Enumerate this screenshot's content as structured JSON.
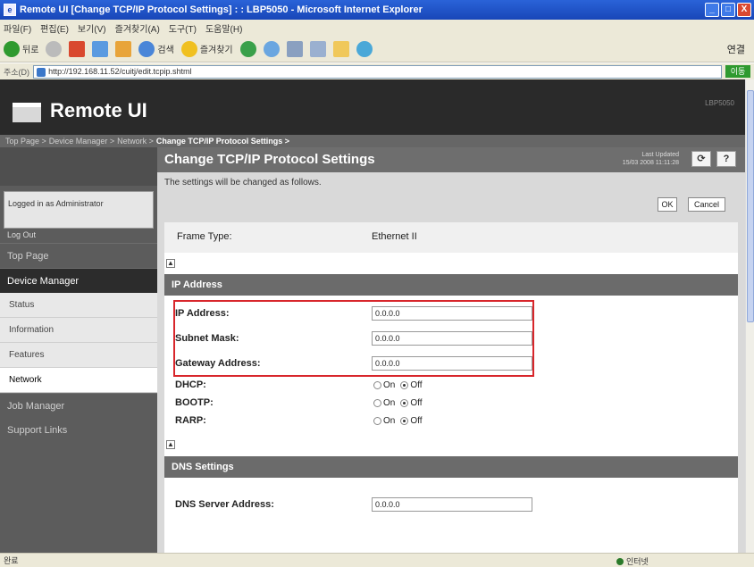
{
  "window": {
    "title": "Remote UI [Change TCP/IP Protocol Settings] : : LBP5050 - Microsoft Internet Explorer",
    "controls": [
      "_",
      "□",
      "X"
    ]
  },
  "menubar": {
    "items": [
      "파일(F)",
      "편집(E)",
      "보기(V)",
      "즐겨찾기(A)",
      "도구(T)",
      "도움말(H)"
    ]
  },
  "toolbar": {
    "back": "뒤로",
    "search": "검색",
    "favorites": "즐겨찾기",
    "links": "연결"
  },
  "addressbar": {
    "label": "주소(D)",
    "url": "http://192.168.11.52/cuitj/edit.tcpip.shtml",
    "go": "이동"
  },
  "header": {
    "logo": "Remote UI",
    "model": "LBP5050"
  },
  "breadcrumb": {
    "items": [
      "Top Page >",
      "Device Manager >",
      "Network >"
    ],
    "current": "Change TCP/IP Protocol Settings >"
  },
  "sidebar": {
    "logged_in": "Logged in as Administrator",
    "logout": "Log Out",
    "top_page": "Top Page",
    "device_manager": "Device Manager",
    "subitems": [
      "Status",
      "Information",
      "Features",
      "Network"
    ],
    "job_manager": "Job Manager",
    "support_links": "Support Links"
  },
  "main": {
    "title": "Change TCP/IP Protocol Settings",
    "last_updated_label": "Last Updated",
    "last_updated_value": "15/03 2008 11:11:28",
    "refresh": "⟳",
    "help": "?",
    "notice": "The settings will be changed as follows.",
    "ok": "OK",
    "cancel": "Cancel",
    "frame_type_label": "Frame Type:",
    "frame_type_value": "Ethernet II",
    "ip_section": "IP Address",
    "ip_label": "IP Address:",
    "ip_value": "0.0.0.0",
    "subnet_label": "Subnet Mask:",
    "subnet_value": "0.0.0.0",
    "gateway_label": "Gateway Address:",
    "gateway_value": "0.0.0.0",
    "dhcp_label": "DHCP:",
    "bootp_label": "BOOTP:",
    "rarp_label": "RARP:",
    "radio_on": "On",
    "radio_off": "Off",
    "dns_section": "DNS Settings",
    "dns_label": "DNS Server Address:",
    "dns_value": "0.0.0.0",
    "collapse_glyph": "▲"
  },
  "statusbar": {
    "left": "완료",
    "zone": "인터넷"
  },
  "colors": {
    "highlight": "#d8262b",
    "banner": "#2a2a2a",
    "section": "#6b6b6b"
  }
}
